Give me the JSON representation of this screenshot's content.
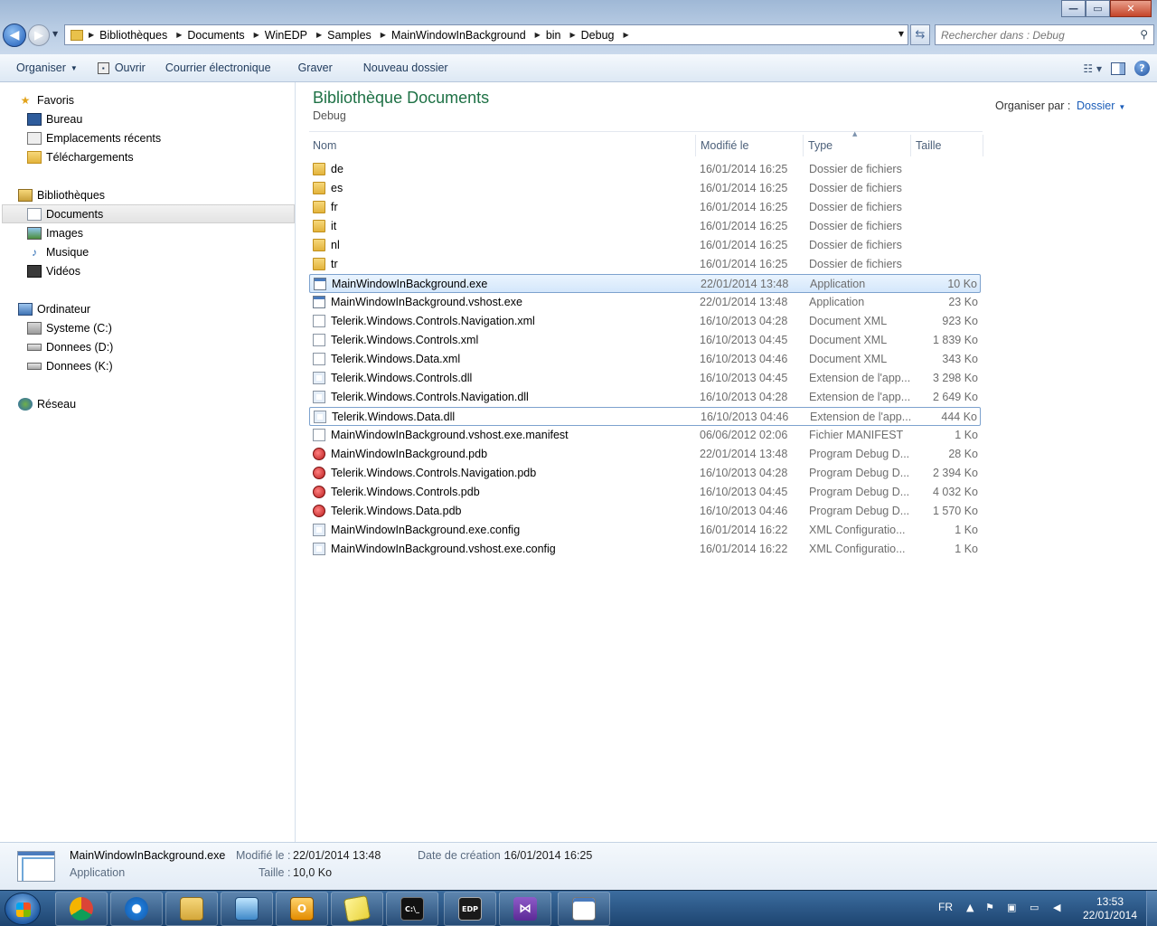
{
  "window": {
    "minimize_label": "—",
    "maximize_label": "▭",
    "close_label": "✕"
  },
  "address": {
    "crumbs": [
      "Bibliothèques",
      "Documents",
      "WinEDP",
      "Samples",
      "MainWindowInBackground",
      "bin",
      "Debug"
    ],
    "search_placeholder": "Rechercher dans : Debug"
  },
  "toolbar": {
    "organize": "Organiser",
    "open": "Ouvrir",
    "email": "Courrier électronique",
    "burn": "Graver",
    "new_folder": "Nouveau dossier"
  },
  "nav": {
    "favorites": "Favoris",
    "desktop": "Bureau",
    "recent": "Emplacements récents",
    "downloads": "Téléchargements",
    "libraries": "Bibliothèques",
    "documents": "Documents",
    "images": "Images",
    "music": "Musique",
    "videos": "Vidéos",
    "computer": "Ordinateur",
    "drive_c": "Systeme (C:)",
    "drive_d": "Donnees (D:)",
    "drive_k": "Donnees (K:)",
    "network": "Réseau"
  },
  "content": {
    "title": "Bibliothèque Documents",
    "subtitle": "Debug",
    "arrange_label": "Organiser par :",
    "arrange_value": "Dossier",
    "columns": {
      "name": "Nom",
      "modified": "Modifié le",
      "type": "Type",
      "size": "Taille"
    },
    "files": [
      {
        "name": "de",
        "date": "16/01/2014 16:25",
        "type": "Dossier de fichiers",
        "size": "",
        "icon": "folder-icon"
      },
      {
        "name": "es",
        "date": "16/01/2014 16:25",
        "type": "Dossier de fichiers",
        "size": "",
        "icon": "folder-icon"
      },
      {
        "name": "fr",
        "date": "16/01/2014 16:25",
        "type": "Dossier de fichiers",
        "size": "",
        "icon": "folder-icon"
      },
      {
        "name": "it",
        "date": "16/01/2014 16:25",
        "type": "Dossier de fichiers",
        "size": "",
        "icon": "folder-icon"
      },
      {
        "name": "nl",
        "date": "16/01/2014 16:25",
        "type": "Dossier de fichiers",
        "size": "",
        "icon": "folder-icon"
      },
      {
        "name": "tr",
        "date": "16/01/2014 16:25",
        "type": "Dossier de fichiers",
        "size": "",
        "icon": "folder-icon"
      },
      {
        "name": "MainWindowInBackground.exe",
        "date": "22/01/2014 13:48",
        "type": "Application",
        "size": "10 Ko",
        "icon": "exe-icon"
      },
      {
        "name": "MainWindowInBackground.vshost.exe",
        "date": "22/01/2014 13:48",
        "type": "Application",
        "size": "23 Ko",
        "icon": "exe-icon"
      },
      {
        "name": "Telerik.Windows.Controls.Navigation.xml",
        "date": "16/10/2013 04:28",
        "type": "Document XML",
        "size": "923 Ko",
        "icon": "xml-icon"
      },
      {
        "name": "Telerik.Windows.Controls.xml",
        "date": "16/10/2013 04:45",
        "type": "Document XML",
        "size": "1 839 Ko",
        "icon": "xml-icon"
      },
      {
        "name": "Telerik.Windows.Data.xml",
        "date": "16/10/2013 04:46",
        "type": "Document XML",
        "size": "343 Ko",
        "icon": "xml-icon"
      },
      {
        "name": "Telerik.Windows.Controls.dll",
        "date": "16/10/2013 04:45",
        "type": "Extension de l'app...",
        "size": "3 298 Ko",
        "icon": "dll-icon"
      },
      {
        "name": "Telerik.Windows.Controls.Navigation.dll",
        "date": "16/10/2013 04:28",
        "type": "Extension de l'app...",
        "size": "2 649 Ko",
        "icon": "dll-icon"
      },
      {
        "name": "Telerik.Windows.Data.dll",
        "date": "16/10/2013 04:46",
        "type": "Extension de l'app...",
        "size": "444 Ko",
        "icon": "dll-icon"
      },
      {
        "name": "MainWindowInBackground.vshost.exe.manifest",
        "date": "06/06/2012 02:06",
        "type": "Fichier MANIFEST",
        "size": "1 Ko",
        "icon": "file-icon"
      },
      {
        "name": "MainWindowInBackground.pdb",
        "date": "22/01/2014 13:48",
        "type": "Program Debug D...",
        "size": "28 Ko",
        "icon": "pdb-icon"
      },
      {
        "name": "Telerik.Windows.Controls.Navigation.pdb",
        "date": "16/10/2013 04:28",
        "type": "Program Debug D...",
        "size": "2 394 Ko",
        "icon": "pdb-icon"
      },
      {
        "name": "Telerik.Windows.Controls.pdb",
        "date": "16/10/2013 04:45",
        "type": "Program Debug D...",
        "size": "4 032 Ko",
        "icon": "pdb-icon"
      },
      {
        "name": "Telerik.Windows.Data.pdb",
        "date": "16/10/2013 04:46",
        "type": "Program Debug D...",
        "size": "1 570 Ko",
        "icon": "pdb-icon"
      },
      {
        "name": "MainWindowInBackground.exe.config",
        "date": "16/01/2014 16:22",
        "type": "XML Configuratio...",
        "size": "1 Ko",
        "icon": "config-icon"
      },
      {
        "name": "MainWindowInBackground.vshost.exe.config",
        "date": "16/01/2014 16:22",
        "type": "XML Configuratio...",
        "size": "1 Ko",
        "icon": "config-icon"
      }
    ]
  },
  "details": {
    "name": "MainWindowInBackground.exe",
    "type": "Application",
    "modified_label": "Modifié le :",
    "modified_value": "22/01/2014 13:48",
    "size_label": "Taille :",
    "size_value": "10,0 Ko",
    "created_label": "Date de création :",
    "created_value": "16/01/2014 16:25"
  },
  "taskbar": {
    "lang": "FR",
    "time": "13:53",
    "date": "22/01/2014",
    "cmd_label": "C:\\_",
    "edp_label": "EDP"
  },
  "colors": {
    "accent_title": "#1e7145",
    "link": "#1b5db9",
    "selection": "#d4e7fb"
  }
}
